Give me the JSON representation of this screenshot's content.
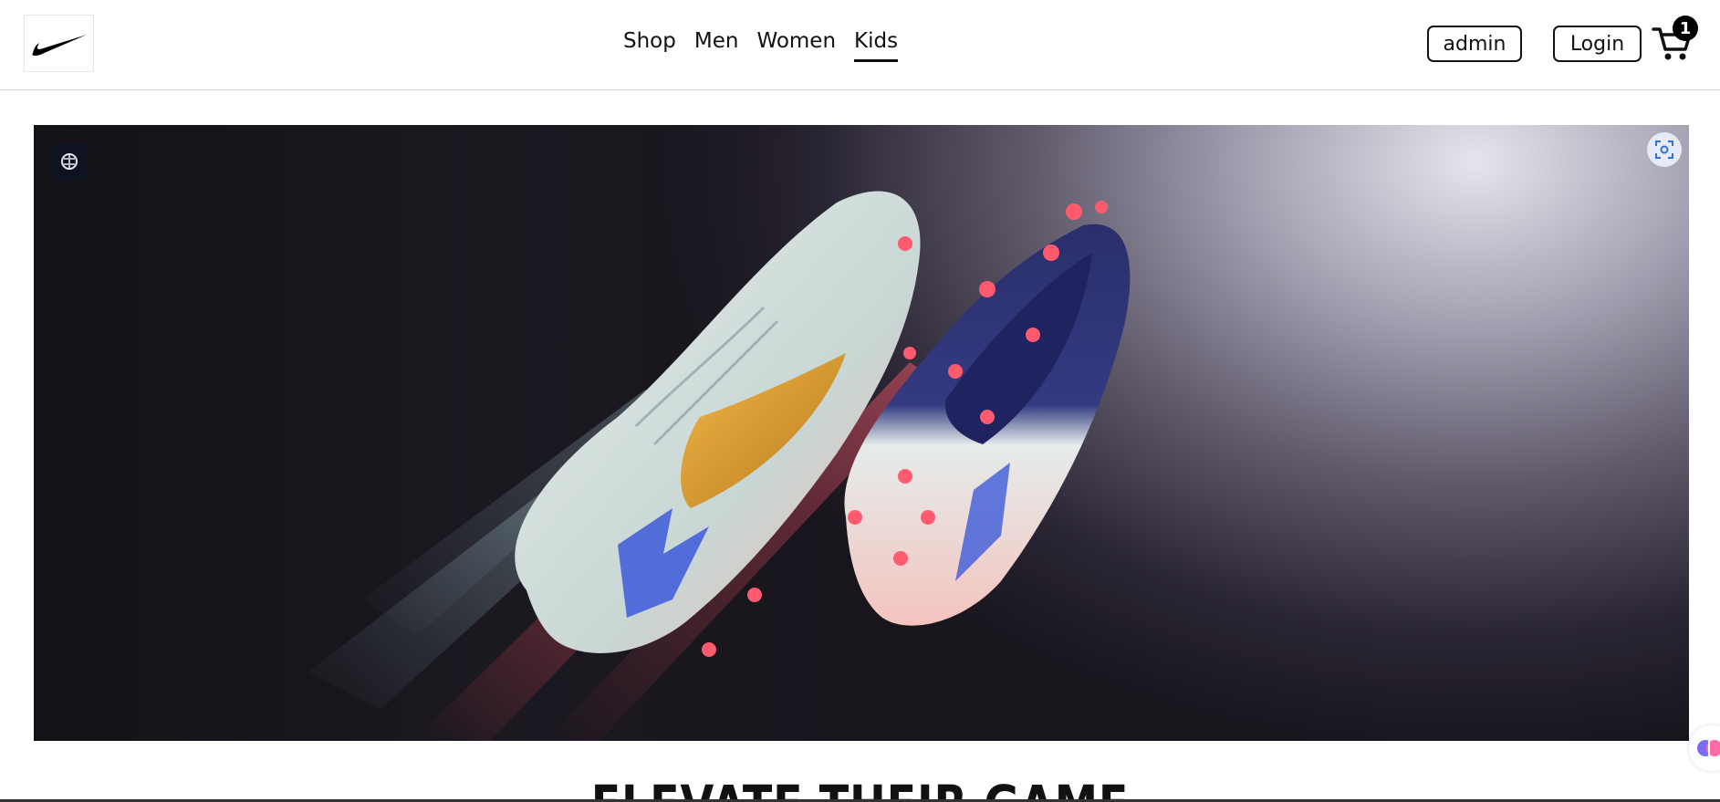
{
  "header": {
    "logo": "nike-swoosh-logo",
    "nav": [
      {
        "label": "Shop",
        "active": false
      },
      {
        "label": "Men",
        "active": false
      },
      {
        "label": "Women",
        "active": false
      },
      {
        "label": "Kids",
        "active": true
      }
    ],
    "admin_label": "admin",
    "login_label": "Login",
    "cart_count": "1"
  },
  "hero": {
    "badge_icon": "brain-icon",
    "scan_icon": "focus-scan-icon"
  },
  "section": {
    "headline": "ELEVATE THEIR GAME"
  },
  "colors": {
    "text": "#111111",
    "hero_dark": "#18151d",
    "hero_light": "#e6e4ec",
    "accent_coral": "#ff5a6e",
    "accent_blue": "#3d5bd9",
    "accent_gold": "#d99a2b"
  }
}
